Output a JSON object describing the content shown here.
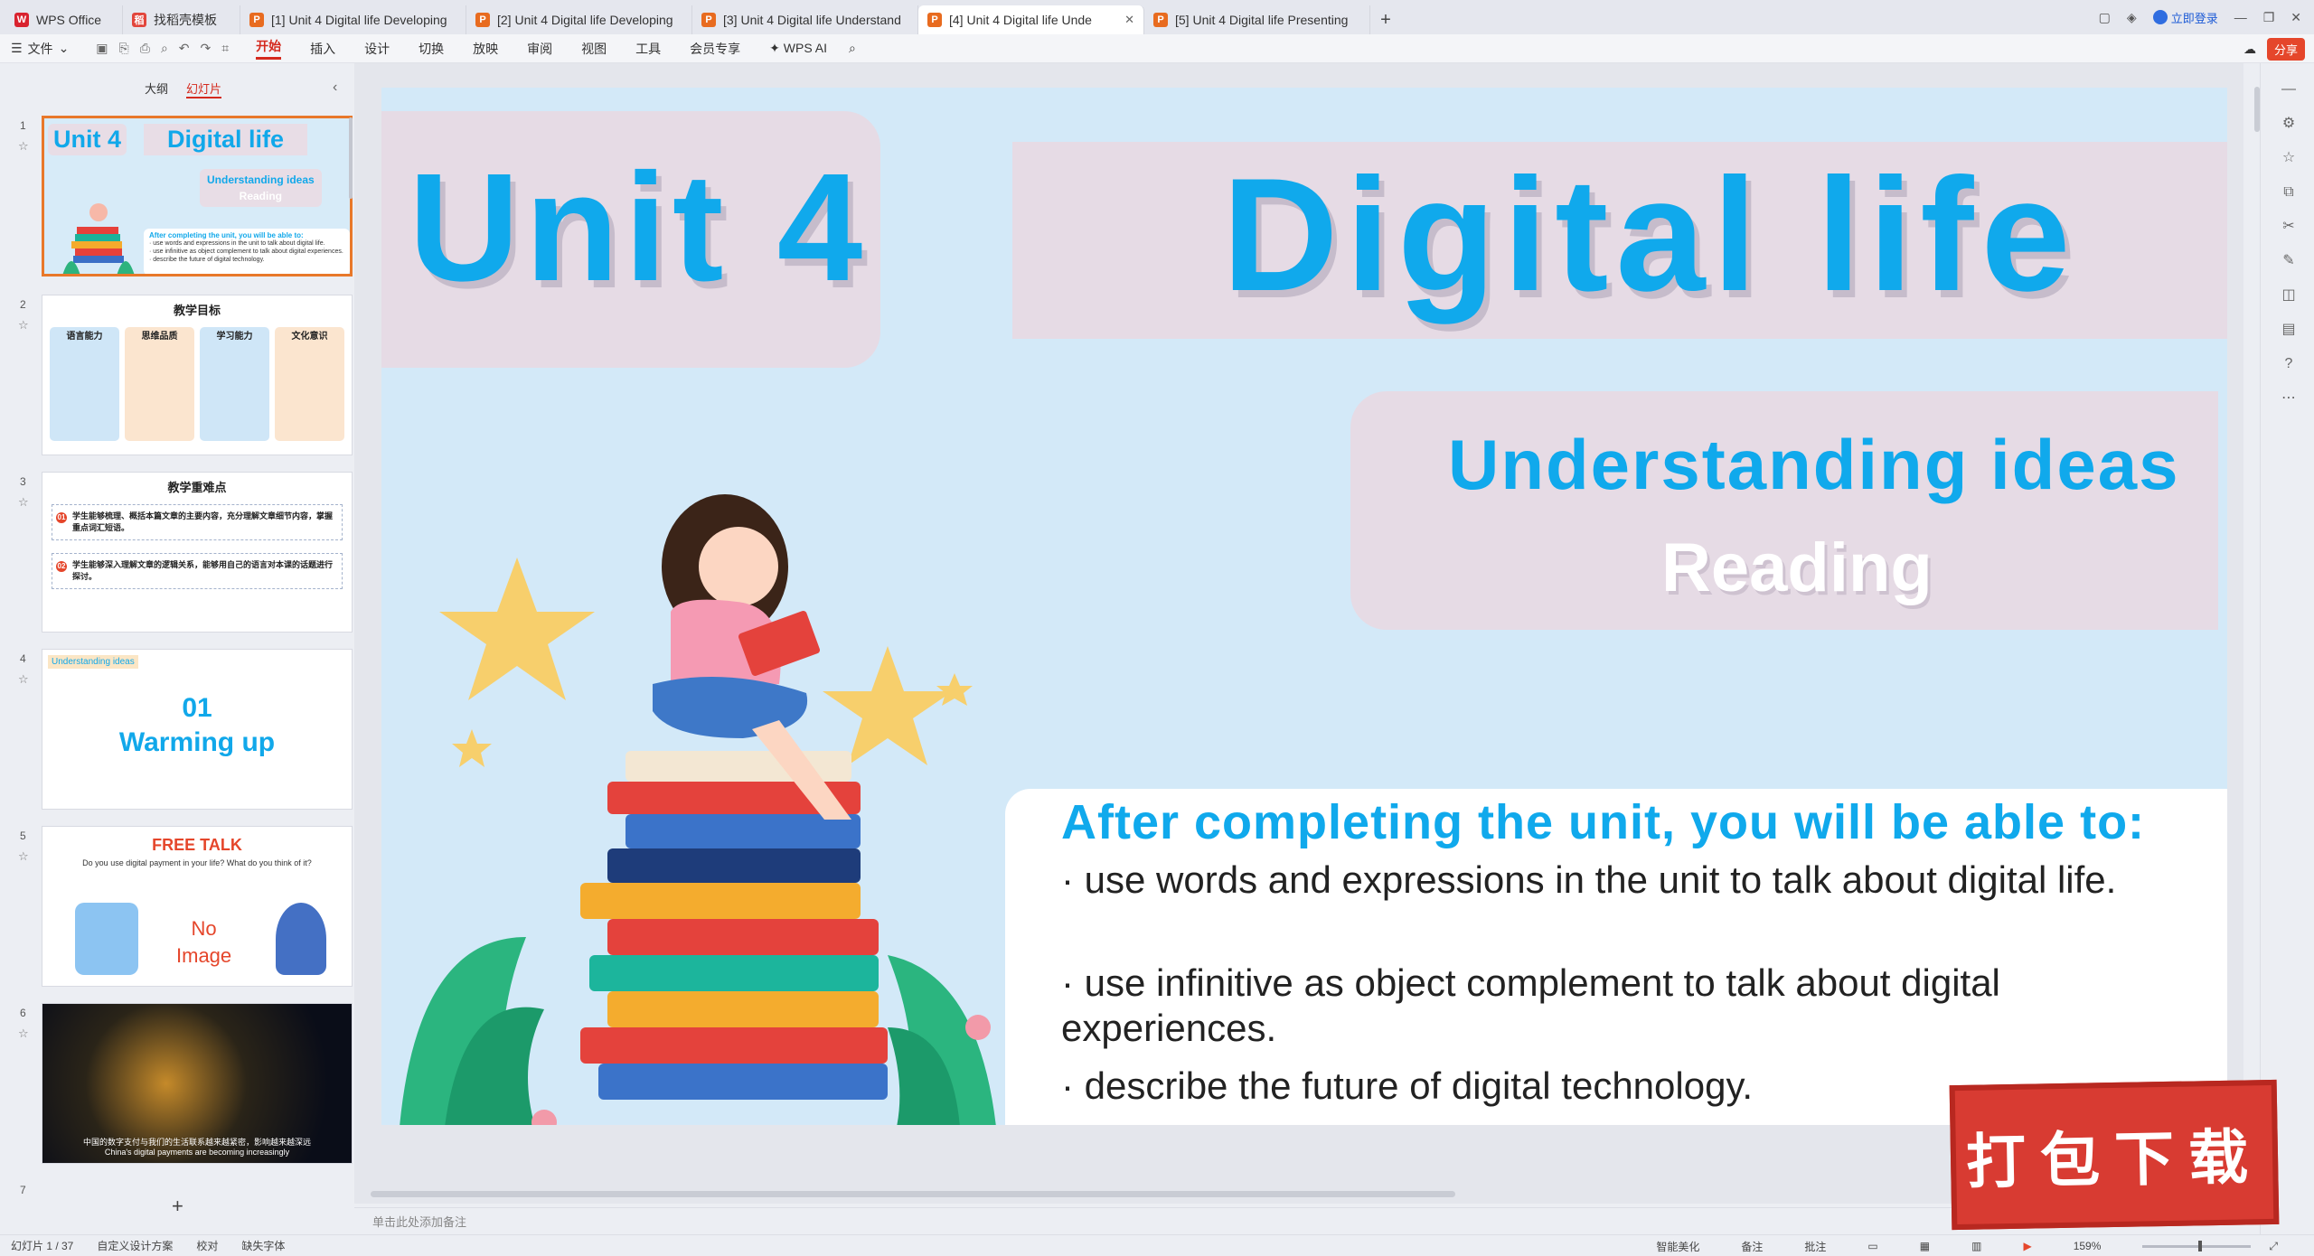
{
  "tabs": [
    {
      "label": "WPS Office",
      "icon": "wps-logo-icon",
      "kind": "home"
    },
    {
      "label": "找稻壳模板",
      "icon": "template-icon",
      "kind": "tpl"
    },
    {
      "label": "[1] Unit 4 Digital life Developing",
      "icon": "ppt-file-icon"
    },
    {
      "label": "[2] Unit 4 Digital life Developing",
      "icon": "ppt-file-icon"
    },
    {
      "label": "[3] Unit 4 Digital life Understand",
      "icon": "ppt-file-icon"
    },
    {
      "label": "[4] Unit 4 Digital life Unde",
      "icon": "ppt-file-icon",
      "active": true
    },
    {
      "label": "[5] Unit 4 Digital life Presenting",
      "icon": "ppt-file-icon"
    }
  ],
  "window": {
    "login_label": "立即登录"
  },
  "ribbon": {
    "file_label": "文件",
    "menu": [
      "开始",
      "插入",
      "设计",
      "切换",
      "放映",
      "审阅",
      "视图",
      "工具",
      "会员专享"
    ],
    "active_menu": "开始",
    "wps_ai": "WPS AI",
    "share_label": "分享"
  },
  "left_panel": {
    "tabs": [
      "大纲",
      "幻灯片"
    ],
    "active_tab": "幻灯片",
    "thumbs": [
      {
        "num": "1"
      },
      {
        "num": "2",
        "title": "教学目标",
        "cols": [
          "语言能力",
          "思维品质",
          "学习能力",
          "文化意识"
        ]
      },
      {
        "num": "3",
        "title": "教学重难点",
        "rows": [
          "学生能够梳理、概括本篇文章的主要内容，充分理解文章细节内容，掌握重点词汇短语。",
          "学生能够深入理解文章的逻辑关系，能够用自己的语言对本课的话题进行探讨。"
        ]
      },
      {
        "num": "4",
        "badge": "Understanding ideas",
        "line1": "01",
        "line2": "Warming up"
      },
      {
        "num": "5",
        "title": "FREE TALK",
        "question": "Do you use digital payment in your life? What do you think of it?",
        "noimg1": "No",
        "noimg2": "Image"
      },
      {
        "num": "6",
        "caption_cn": "中国的数字支付与我们的生活联系越来越紧密，影响越来越深远",
        "caption_en": "China's digital payments are becoming increasingly"
      },
      {
        "num": "7"
      }
    ]
  },
  "slide": {
    "unit": "Unit 4",
    "title": "Digital life",
    "subtitle": "Understanding ideas",
    "section": "Reading",
    "goals_title": "After completing the unit, you will be able to:",
    "goals": [
      "·  use words and expressions in the unit to talk about digital life.",
      "·  use infinitive as object complement to talk about digital experiences.",
      "·  describe the future of digital technology."
    ]
  },
  "thumb1": {
    "unit": "Unit 4",
    "title": "Digital life",
    "sub1": "Understanding ideas",
    "sub2": "Reading",
    "goals_title": "After completing the unit, you will be able to:",
    "goals": [
      "·  use words and expressions in the unit to talk about digital life.",
      "·  use infinitive as object complement to talk about digital experiences.",
      "·  describe the future of digital technology."
    ]
  },
  "notes_placeholder": "单击此处添加备注",
  "status": {
    "slide_counter": "幻灯片 1 / 37",
    "design": "自定义设计方案",
    "proof": "校对",
    "font_missing": "缺失字体",
    "beautify": "智能美化",
    "notes": "备注",
    "comments": "批注",
    "zoom": "159%"
  },
  "stamp_text": "打包下载",
  "colors": {
    "accent": "#d42a1e",
    "title_blue": "#10a9ec",
    "slide_bg": "#d3e9f8",
    "panel_pink": "#e6dbe5"
  }
}
